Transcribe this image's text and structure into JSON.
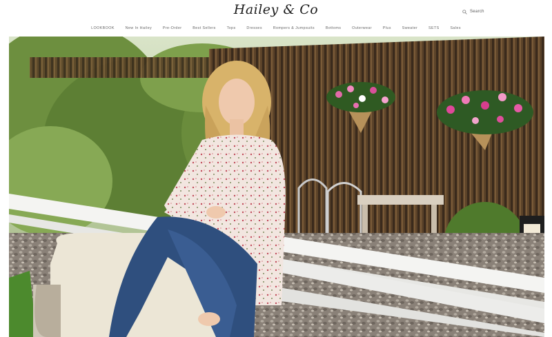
{
  "brand": {
    "logo_text": "Hailey & Co"
  },
  "search": {
    "label": "Search",
    "icon": "search-icon"
  },
  "nav": {
    "items": [
      {
        "label": "LOOKBOOK"
      },
      {
        "label": "New In Hailey"
      },
      {
        "label": "Pre-Order"
      },
      {
        "label": "Best Sellers"
      },
      {
        "label": "Tops"
      },
      {
        "label": "Dresses"
      },
      {
        "label": "Rompers & Jumpsuits"
      },
      {
        "label": "Bottoms"
      },
      {
        "label": "Outerwear"
      },
      {
        "label": "Plus"
      },
      {
        "label": "Sweater"
      },
      {
        "label": "SETS"
      },
      {
        "label": "Sales"
      }
    ]
  },
  "hero": {
    "type": "lifestyle-photo"
  },
  "colors": {
    "text": "#222222",
    "nav_text": "#666666",
    "background": "#ffffff"
  }
}
